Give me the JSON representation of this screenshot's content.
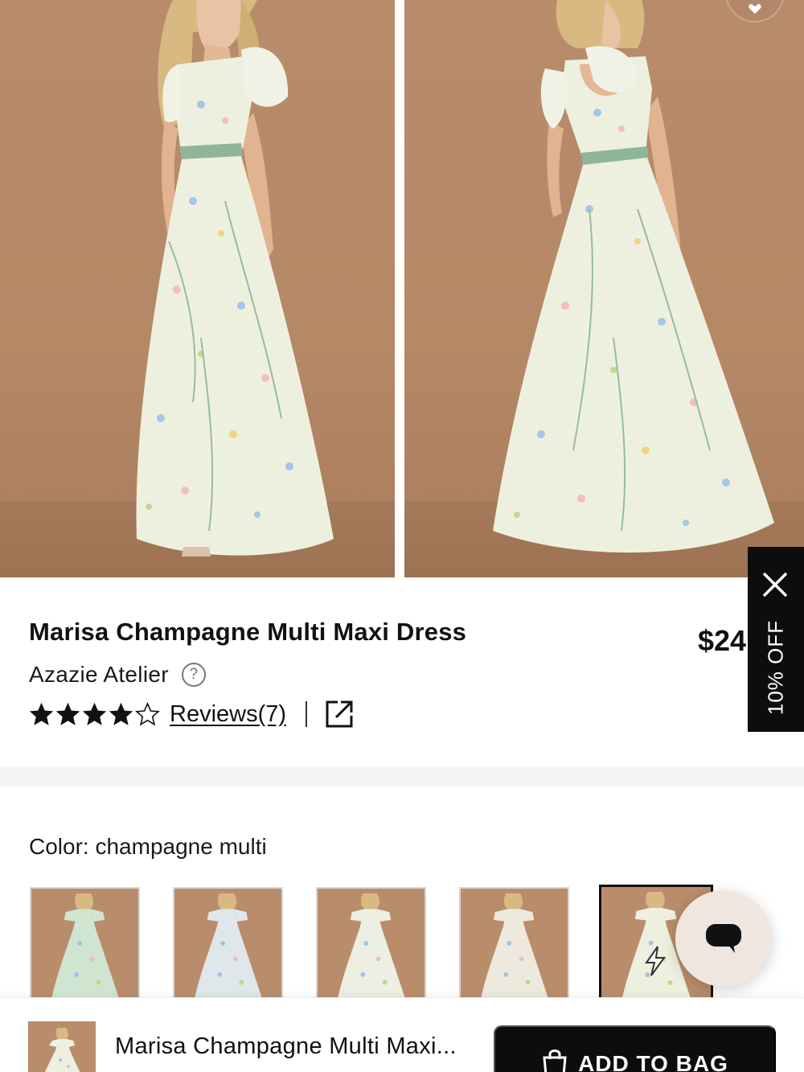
{
  "product": {
    "title": "Marisa Champagne Multi Maxi Dress",
    "price": "$24",
    "brand": "Azazie Atelier",
    "help_symbol": "?",
    "rating": 4,
    "rating_max": 5,
    "reviews_label": "Reviews(7)"
  },
  "discount": {
    "label": "10% OFF"
  },
  "color": {
    "label": "Color: champagne multi",
    "swatch_count": 5,
    "selected_index": 4
  },
  "bottom_bar": {
    "title": "Marisa Champagne Multi Maxi...",
    "add_to_bag_label": "ADD TO BAG"
  },
  "icons": {
    "favorite": "heart-icon",
    "help": "question-circle-icon",
    "star_full": "star-filled-icon",
    "star_empty": "star-outline-icon",
    "share": "external-link-icon",
    "close": "close-icon",
    "chat": "chat-bubble-icon",
    "bag": "shopping-bag-icon",
    "flash": "lightning-icon"
  },
  "colors": {
    "backdrop": "#b88c6b",
    "dress": "#eef0df",
    "dress_swatch_green": "#cfe5cf",
    "sash": "#8fb59a",
    "black": "#0d0d0d",
    "chat_bg": "#efe7df"
  }
}
